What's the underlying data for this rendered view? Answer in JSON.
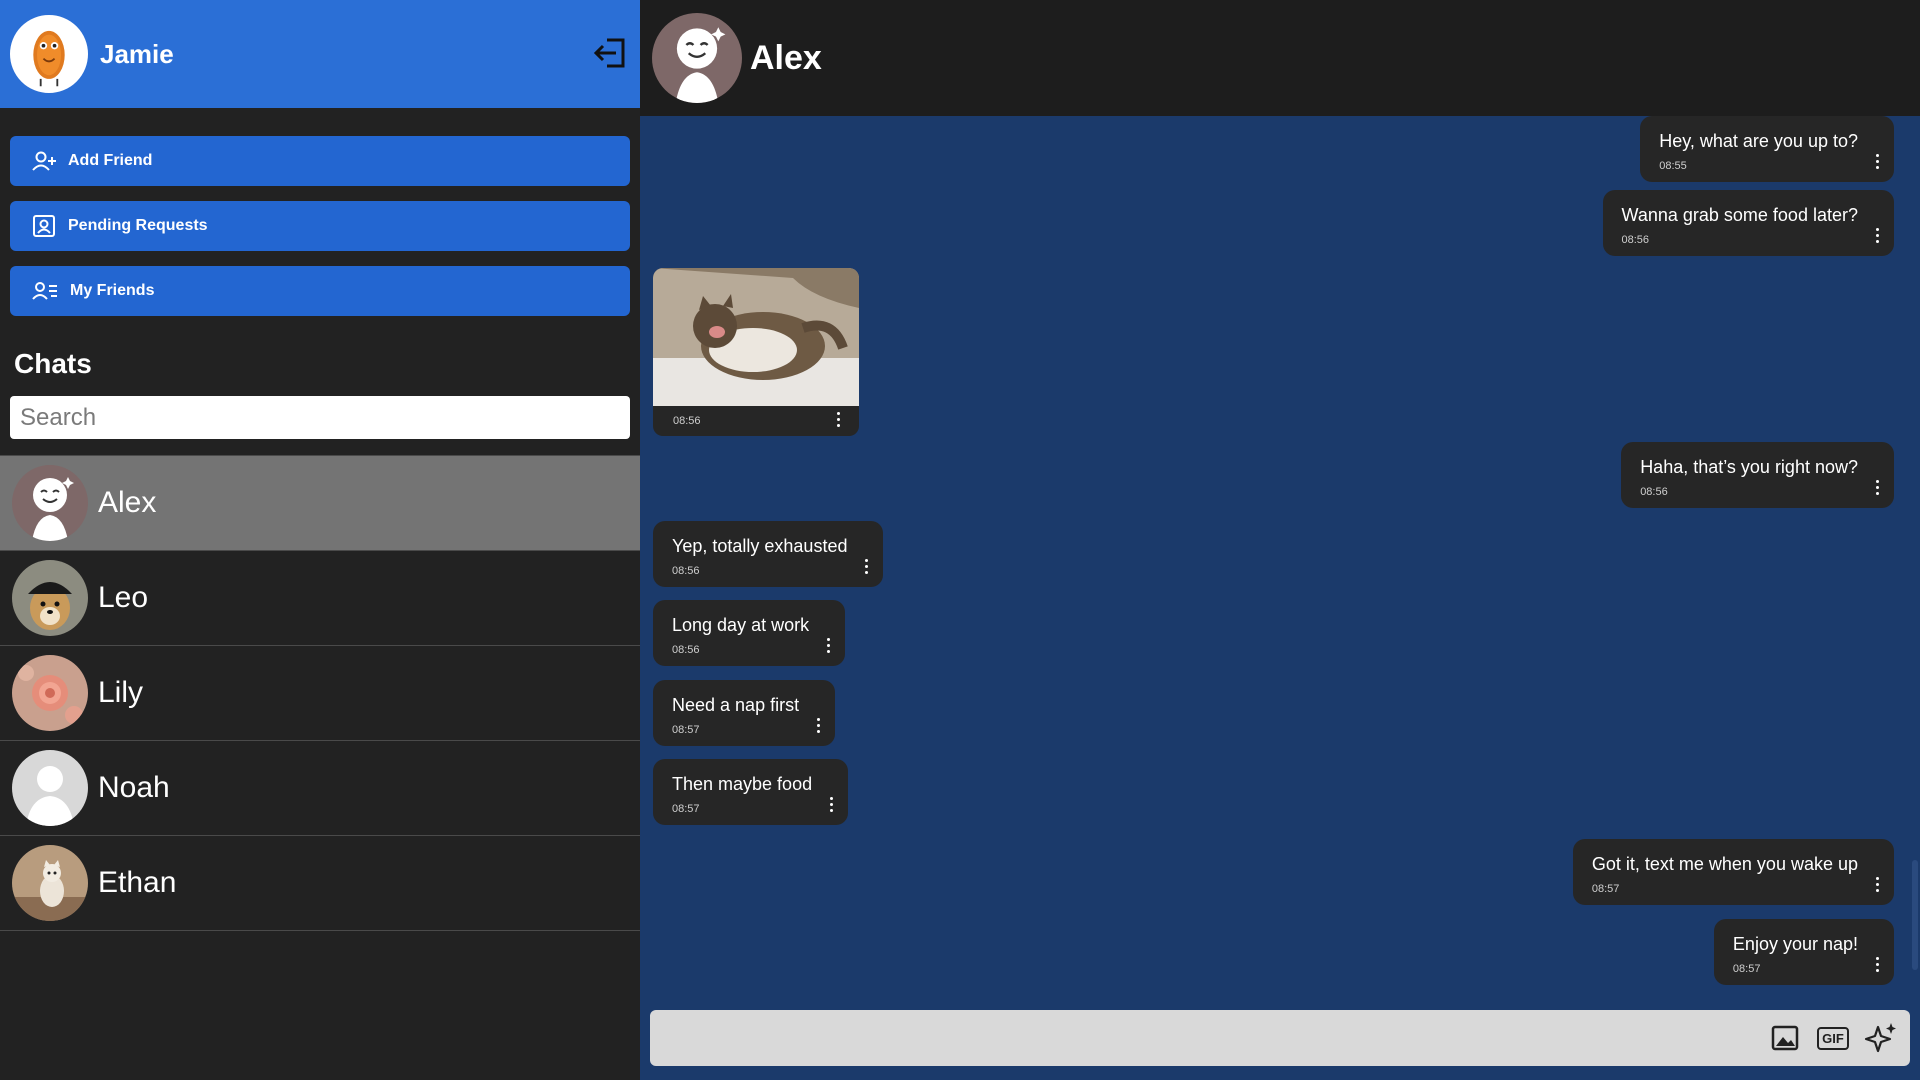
{
  "user": {
    "name": "Jamie"
  },
  "nav": {
    "add_friend": "Add Friend",
    "pending_requests": "Pending Requests",
    "my_friends": "My Friends"
  },
  "chats_title": "Chats",
  "search": {
    "placeholder": "Search",
    "value": ""
  },
  "chat_list": [
    {
      "name": "Alex",
      "active": true
    },
    {
      "name": "Leo",
      "active": false
    },
    {
      "name": "Lily",
      "active": false
    },
    {
      "name": "Noah",
      "active": false
    },
    {
      "name": "Ethan",
      "active": false
    }
  ],
  "conversation": {
    "contact_name": "Alex",
    "messages": [
      {
        "side": "right",
        "text": "Hey, what are you up to?",
        "time": "08:55"
      },
      {
        "side": "right",
        "text": "Wanna grab some food later?",
        "time": "08:56"
      },
      {
        "side": "left",
        "type": "image",
        "time": "08:56"
      },
      {
        "side": "right",
        "text": "Haha, that’s you right now?",
        "time": "08:56"
      },
      {
        "side": "left",
        "text": "Yep, totally exhausted",
        "time": "08:56"
      },
      {
        "side": "left",
        "text": "Long day at work",
        "time": "08:56"
      },
      {
        "side": "left",
        "text": "Need a nap first",
        "time": "08:57"
      },
      {
        "side": "left",
        "text": "Then maybe food",
        "time": "08:57"
      },
      {
        "side": "right",
        "text": "Got it, text me when you wake up",
        "time": "08:57"
      },
      {
        "side": "right",
        "text": "Enjoy your nap!",
        "time": "08:57"
      }
    ]
  },
  "composer": {
    "value": "",
    "gif_label": "GIF"
  },
  "icons": {
    "logout": "logout-icon",
    "add_friend": "person-add-icon",
    "pending": "contact-card-icon",
    "friends": "people-list-icon",
    "image": "image-icon",
    "gif": "gif-icon",
    "sparkle": "sparkle-icon"
  },
  "colors": {
    "header_blue": "#2b6fd6",
    "nav_blue": "#2366d1",
    "sidebar_bg": "#222222",
    "conversation_bg": "#1b3a6b",
    "bubble_bg": "#262626",
    "active_chat": "#747474"
  }
}
